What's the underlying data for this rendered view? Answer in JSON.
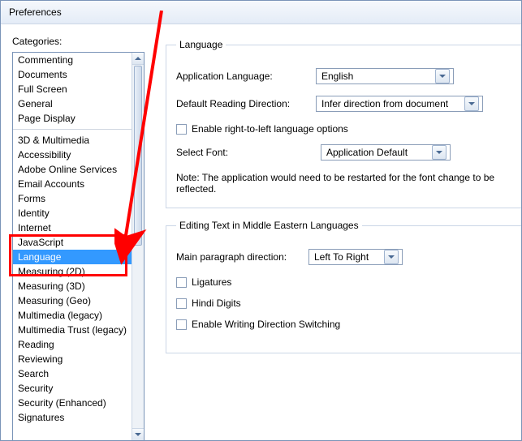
{
  "window": {
    "title": "Preferences"
  },
  "sidebar": {
    "label": "Categories:",
    "group1": [
      {
        "label": "Commenting"
      },
      {
        "label": "Documents"
      },
      {
        "label": "Full Screen"
      },
      {
        "label": "General"
      },
      {
        "label": "Page Display"
      }
    ],
    "group2": [
      {
        "label": "3D & Multimedia"
      },
      {
        "label": "Accessibility"
      },
      {
        "label": "Adobe Online Services"
      },
      {
        "label": "Email Accounts"
      },
      {
        "label": "Forms"
      },
      {
        "label": "Identity"
      },
      {
        "label": "Internet"
      },
      {
        "label": "JavaScript"
      },
      {
        "label": "Language"
      },
      {
        "label": "Measuring (2D)"
      },
      {
        "label": "Measuring (3D)"
      },
      {
        "label": "Measuring (Geo)"
      },
      {
        "label": "Multimedia (legacy)"
      },
      {
        "label": "Multimedia Trust (legacy)"
      },
      {
        "label": "Reading"
      },
      {
        "label": "Reviewing"
      },
      {
        "label": "Search"
      },
      {
        "label": "Security"
      },
      {
        "label": "Security (Enhanced)"
      },
      {
        "label": "Signatures"
      }
    ],
    "selected": "Language"
  },
  "language_panel": {
    "legend": "Language",
    "app_lang_label": "Application Language:",
    "app_lang_value": "English",
    "reading_dir_label": "Default Reading Direction:",
    "reading_dir_value": "Infer direction from document",
    "rtl_checkbox": "Enable right-to-left language options",
    "select_font_label": "Select Font:",
    "select_font_value": "Application Default",
    "note": "Note: The application would need to be restarted for the font change to be reflected."
  },
  "editing_panel": {
    "legend": "Editing Text in Middle Eastern Languages",
    "para_dir_label": "Main paragraph direction:",
    "para_dir_value": "Left To Right",
    "ligatures": "Ligatures",
    "hindi_digits": "Hindi Digits",
    "writing_switch": "Enable Writing Direction Switching"
  },
  "annotation": {
    "highlight_target": "Language"
  }
}
